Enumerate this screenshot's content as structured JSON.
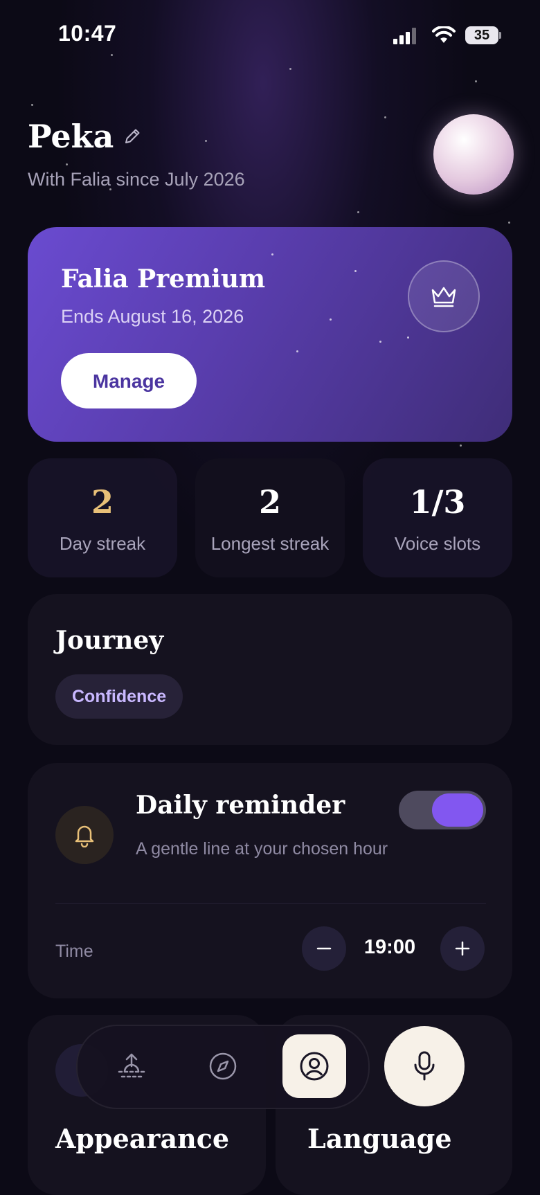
{
  "status_bar": {
    "time": "10:47",
    "battery": "35"
  },
  "profile": {
    "name": "Peka",
    "since": "With Falia since July 2026"
  },
  "premium": {
    "title": "Falia Premium",
    "ends": "Ends August 16, 2026",
    "manage_label": "Manage"
  },
  "stats": [
    {
      "value": "2",
      "label": "Day streak",
      "color": "#e8c078"
    },
    {
      "value": "2",
      "label": "Longest streak"
    },
    {
      "value": "1/3",
      "label": "Voice slots"
    }
  ],
  "journey": {
    "title": "Journey",
    "tag": "Confidence"
  },
  "reminder": {
    "title": "Daily reminder",
    "subtitle": "A gentle line at your chosen hour",
    "enabled": true,
    "time_label": "Time",
    "time_value": "19:00"
  },
  "settings_cards": [
    {
      "title": "Appearance"
    },
    {
      "title": "Language"
    }
  ],
  "nav": {
    "items": [
      "sunrise-icon",
      "compass-icon",
      "profile-icon"
    ],
    "active": "profile-icon",
    "mic": "microphone-icon"
  },
  "colors": {
    "accent": "#8257f0",
    "cream": "#f7f1e8",
    "gold": "#e8c078"
  }
}
